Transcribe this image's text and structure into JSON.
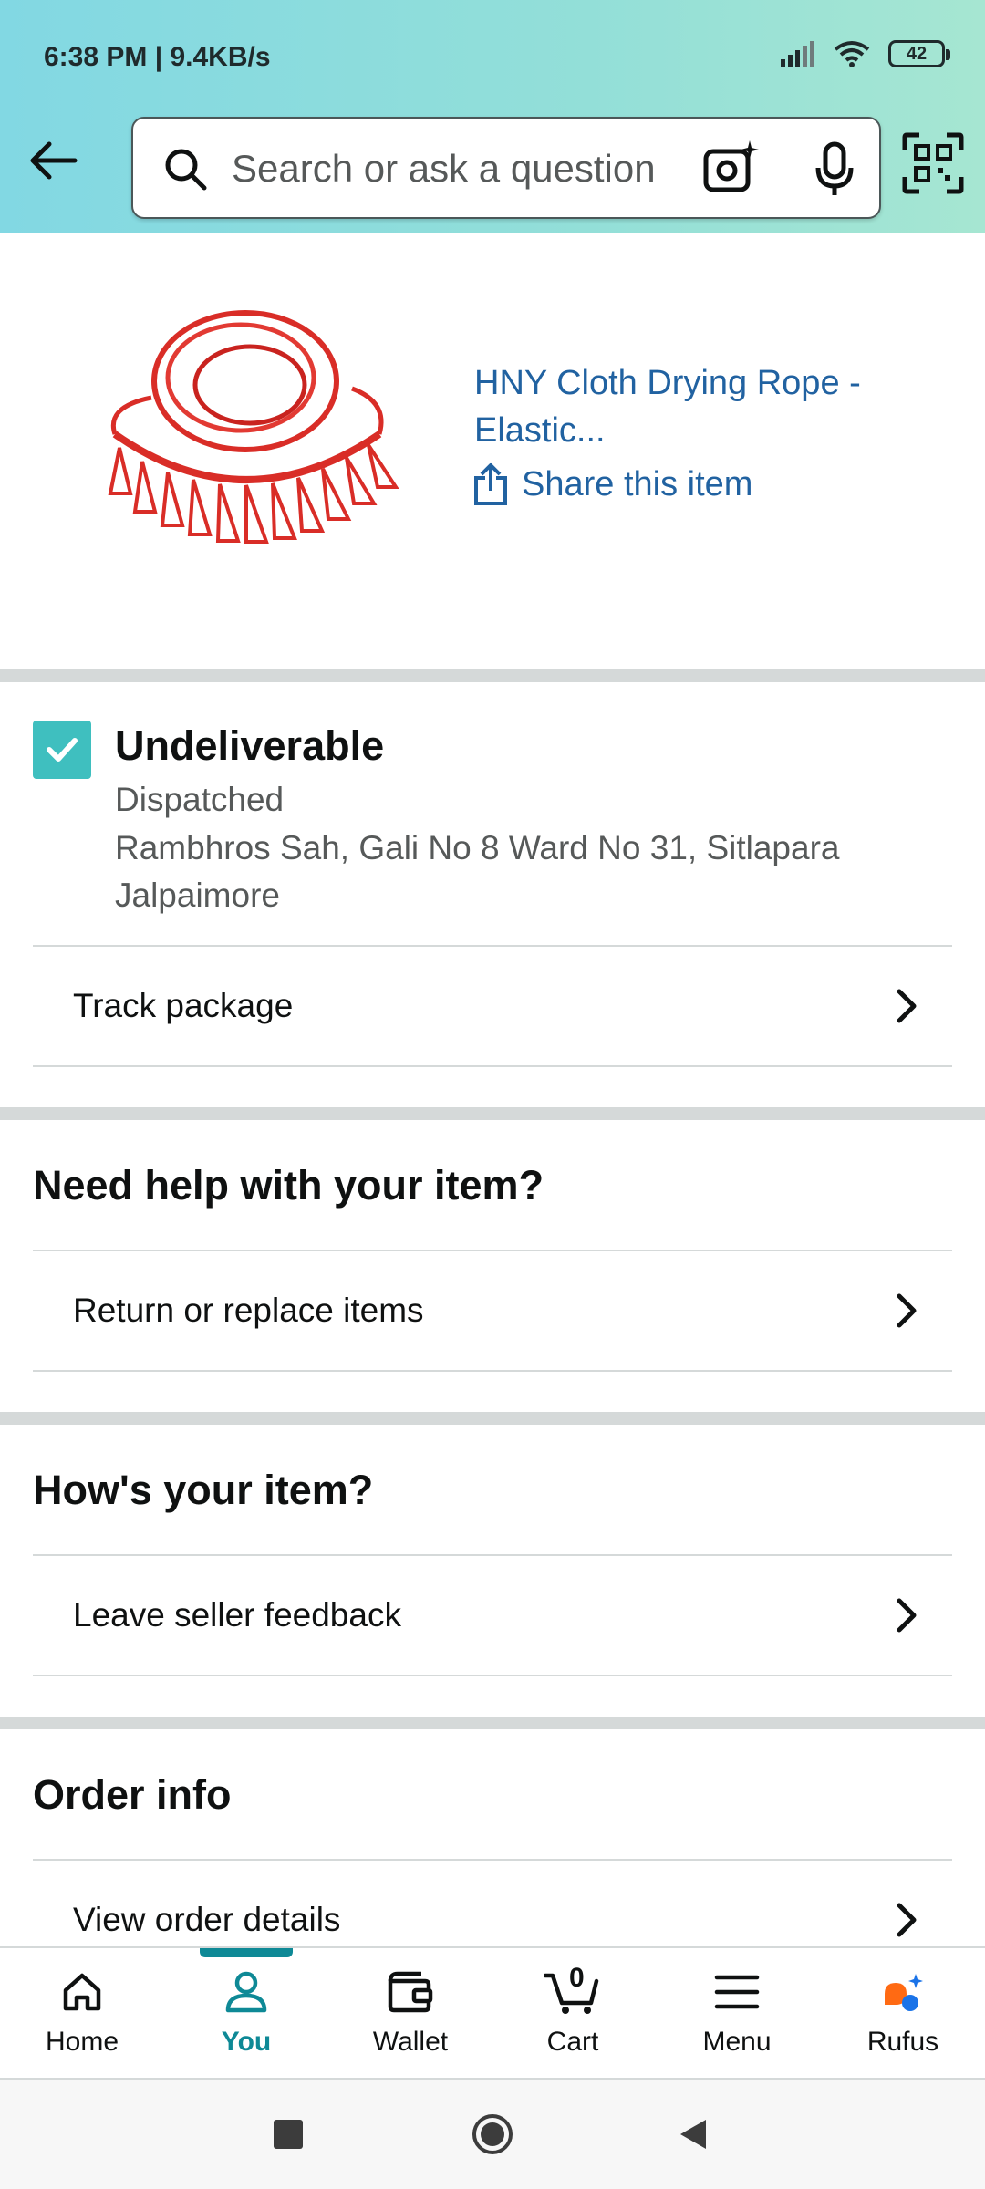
{
  "status_bar": {
    "time": "6:38 PM",
    "speed": "9.4KB/s",
    "battery": "42"
  },
  "search": {
    "placeholder": "Search or ask a question"
  },
  "product": {
    "title_line1": "HNY Cloth Drying Rope -",
    "title_line2": "Elastic...",
    "share_label": "Share this item"
  },
  "shipment": {
    "status": "Undeliverable",
    "substatus": "Dispatched",
    "address_line1": "Rambhros Sah, Gali No 8 Ward No 31, Sitlapara",
    "address_line2": "Jalpaimore",
    "track_label": "Track package"
  },
  "help": {
    "heading": "Need help with your item?",
    "return_label": "Return or replace items"
  },
  "feedback": {
    "heading": "How's your item?",
    "seller_label": "Leave seller feedback"
  },
  "order_info": {
    "heading": "Order info",
    "details_label": "View order details"
  },
  "bottom_nav": {
    "home": "Home",
    "you": "You",
    "wallet": "Wallet",
    "cart": "Cart",
    "cart_count": "0",
    "menu": "Menu",
    "rufus": "Rufus"
  },
  "colors": {
    "accent": "#0e8996",
    "link": "#2162a1",
    "check": "#3fbfbf",
    "rufus_orange": "#ff6a13",
    "rufus_blue": "#1a73e8"
  }
}
